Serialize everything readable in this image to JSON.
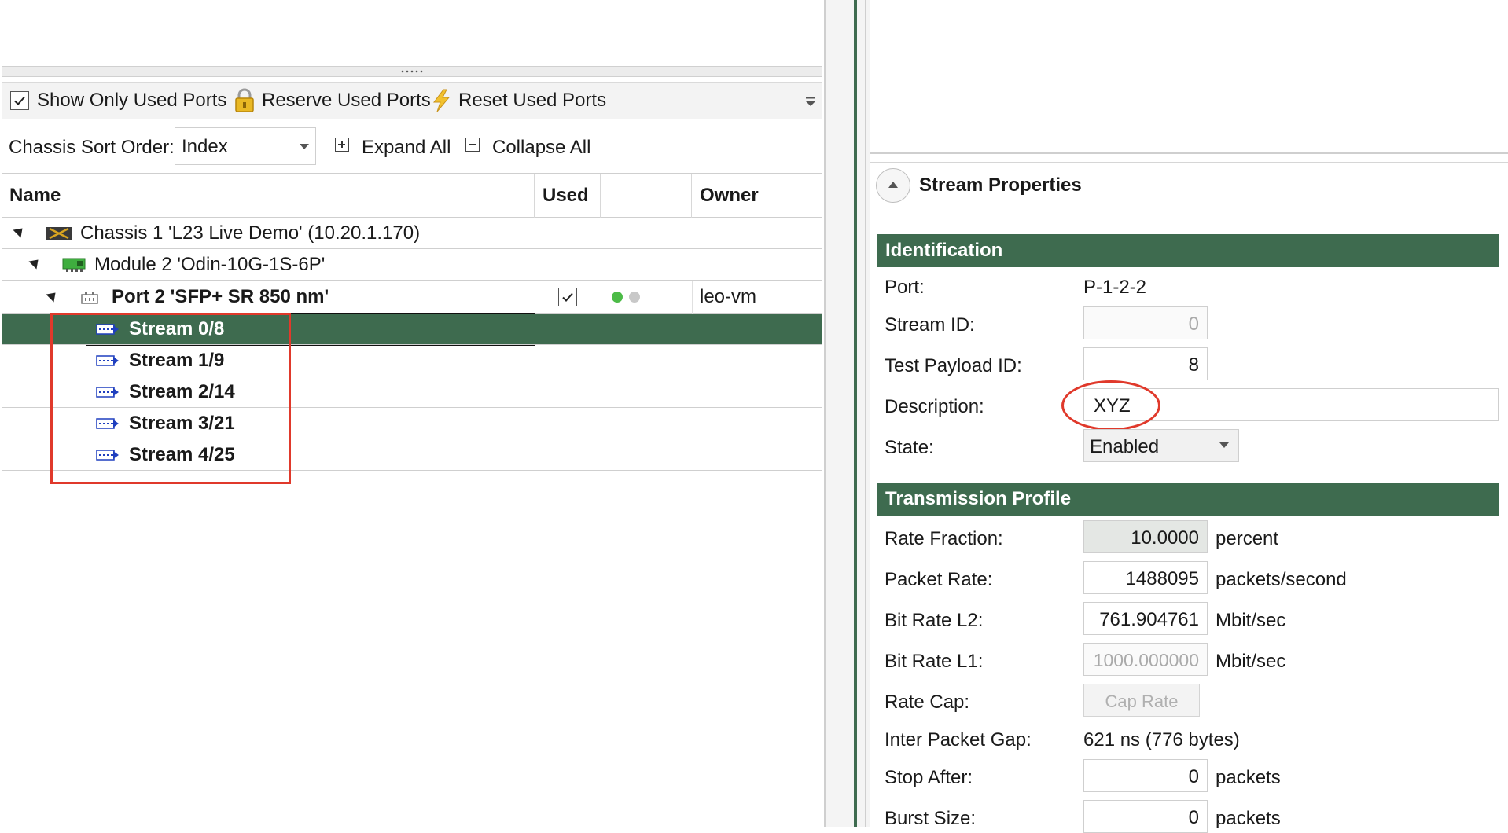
{
  "toolbar": {
    "show_only_used_ports": "Show Only Used Ports",
    "reserve_used_ports": "Reserve Used Ports",
    "reset_used_ports": "Reset Used Ports",
    "show_only_used_checked": true
  },
  "sort": {
    "label": "Chassis Sort Order:",
    "value": "Index",
    "expand_all": "Expand All",
    "collapse_all": "Collapse All"
  },
  "grid": {
    "columns": {
      "name": "Name",
      "used": "Used",
      "status": "",
      "owner": "Owner"
    },
    "chassis": "Chassis 1 'L23 Live Demo' (10.20.1.170)",
    "module": "Module 2 'Odin-10G-1S-6P'",
    "port": {
      "label": "Port 2 'SFP+ SR 850 nm'",
      "used": true,
      "owner": "leo-vm"
    },
    "streams": [
      "Stream 0/8",
      "Stream 1/9",
      "Stream 2/14",
      "Stream 3/21",
      "Stream 4/25"
    ],
    "selected_stream_index": 0
  },
  "colors": {
    "accent_green": "#3e6b4f",
    "annotation_red": "#e0392b",
    "status_green": "#4cbb47",
    "status_grey": "#c8c8c8"
  },
  "panel": {
    "title": "Stream Properties",
    "identification": {
      "header": "Identification",
      "port_label": "Port:",
      "port_value": "P-1-2-2",
      "stream_id_label": "Stream ID:",
      "stream_id_value": "0",
      "test_payload_label": "Test Payload ID:",
      "test_payload_value": "8",
      "description_label": "Description:",
      "description_value": "XYZ",
      "state_label": "State:",
      "state_value": "Enabled"
    },
    "transmission": {
      "header": "Transmission Profile",
      "rate_fraction_label": "Rate Fraction:",
      "rate_fraction_value": "10.0000",
      "rate_fraction_unit": "percent",
      "packet_rate_label": "Packet Rate:",
      "packet_rate_value": "1488095",
      "packet_rate_unit": "packets/second",
      "bit_rate_l2_label": "Bit Rate L2:",
      "bit_rate_l2_value": "761.904761",
      "bit_rate_l2_unit": "Mbit/sec",
      "bit_rate_l1_label": "Bit Rate L1:",
      "bit_rate_l1_value": "1000.000000",
      "bit_rate_l1_unit": "Mbit/sec",
      "rate_cap_label": "Rate Cap:",
      "rate_cap_button": "Cap Rate",
      "ipg_label": "Inter Packet Gap:",
      "ipg_value": "621 ns (776 bytes)",
      "stop_after_label": "Stop After:",
      "stop_after_value": "0",
      "stop_after_unit": "packets",
      "burst_size_label": "Burst Size:",
      "burst_size_value": "0",
      "burst_size_unit": "packets"
    }
  },
  "icons": [
    "checkbox-checked-icon",
    "lock-icon",
    "lightning-icon",
    "overflow-chevron-icon",
    "expand-plus-icon",
    "collapse-minus-icon",
    "chassis-icon",
    "module-icon",
    "port-icon",
    "stream-icon",
    "collapse-up-icon"
  ]
}
